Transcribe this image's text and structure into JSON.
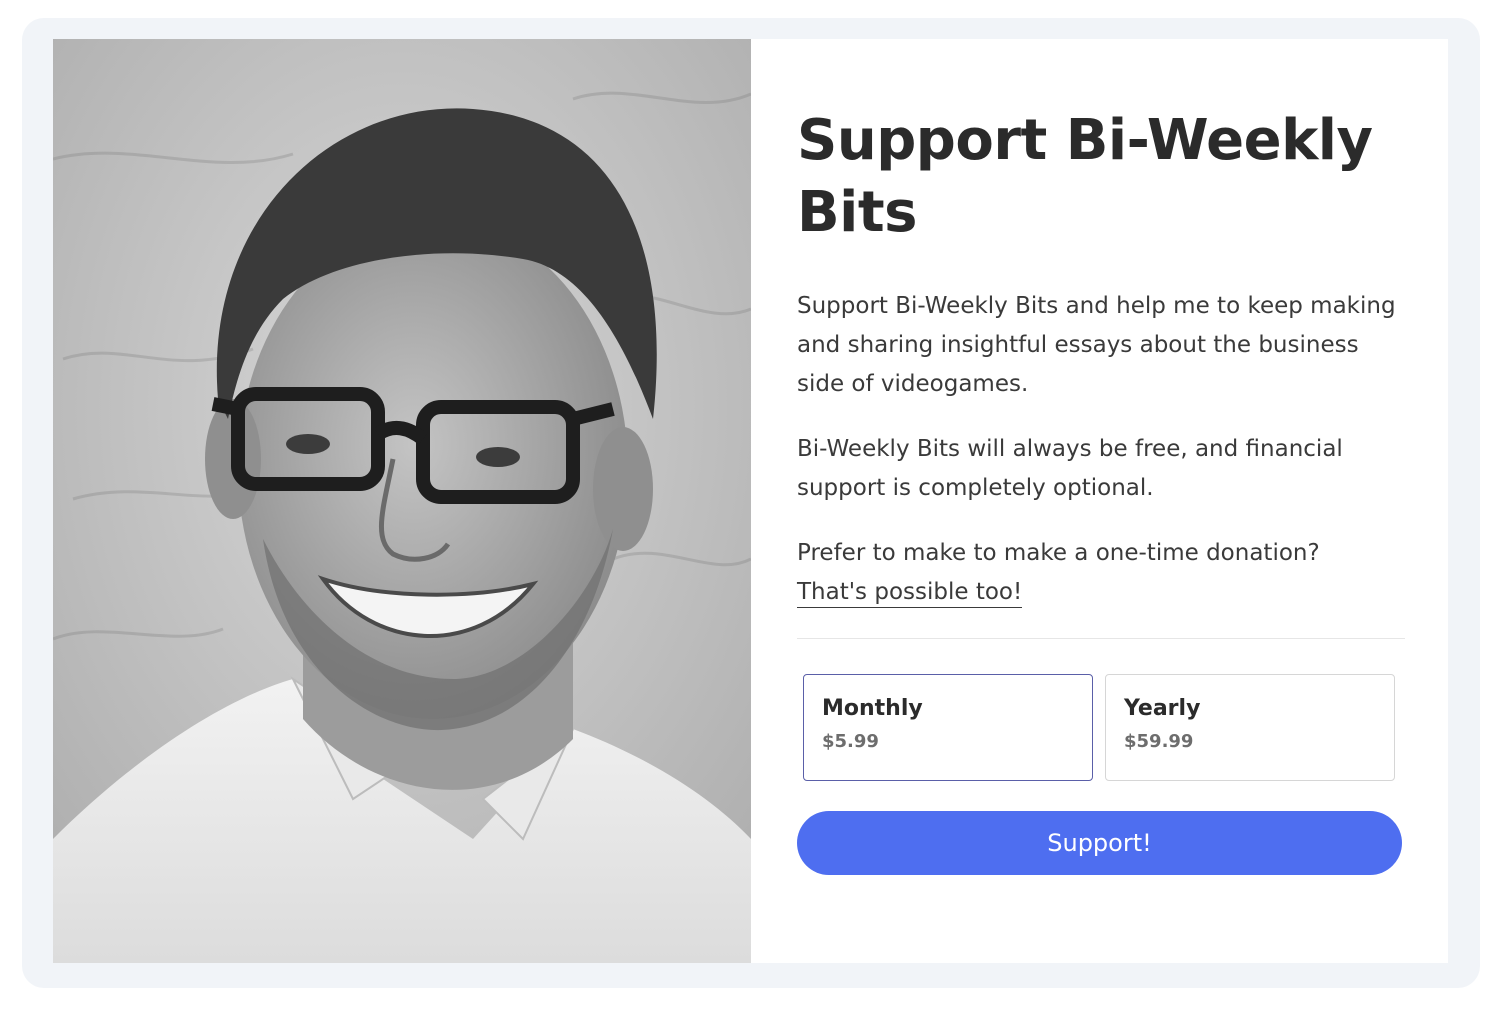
{
  "title": "Support Bi-Weekly Bits",
  "paragraphs": {
    "intro": "Support Bi-Weekly Bits and help me to keep making and sharing insightful essays about the business side of videogames.",
    "free_note": "Bi-Weekly Bits will always be free, and financial support is completely optional.",
    "donation_prefix": "Prefer to make to make a one-time donation?",
    "donation_link": "That's possible too!"
  },
  "plans": [
    {
      "name": "Monthly",
      "price": "$5.99",
      "selected": true
    },
    {
      "name": "Yearly",
      "price": "$59.99",
      "selected": false
    }
  ],
  "button": {
    "label": "Support!"
  },
  "colors": {
    "accent": "#4e6ef0",
    "selected_border": "#5a5fa8",
    "frame": "#f1f4f8"
  },
  "image": {
    "subject": "author-portrait",
    "style": "black-and-white"
  }
}
